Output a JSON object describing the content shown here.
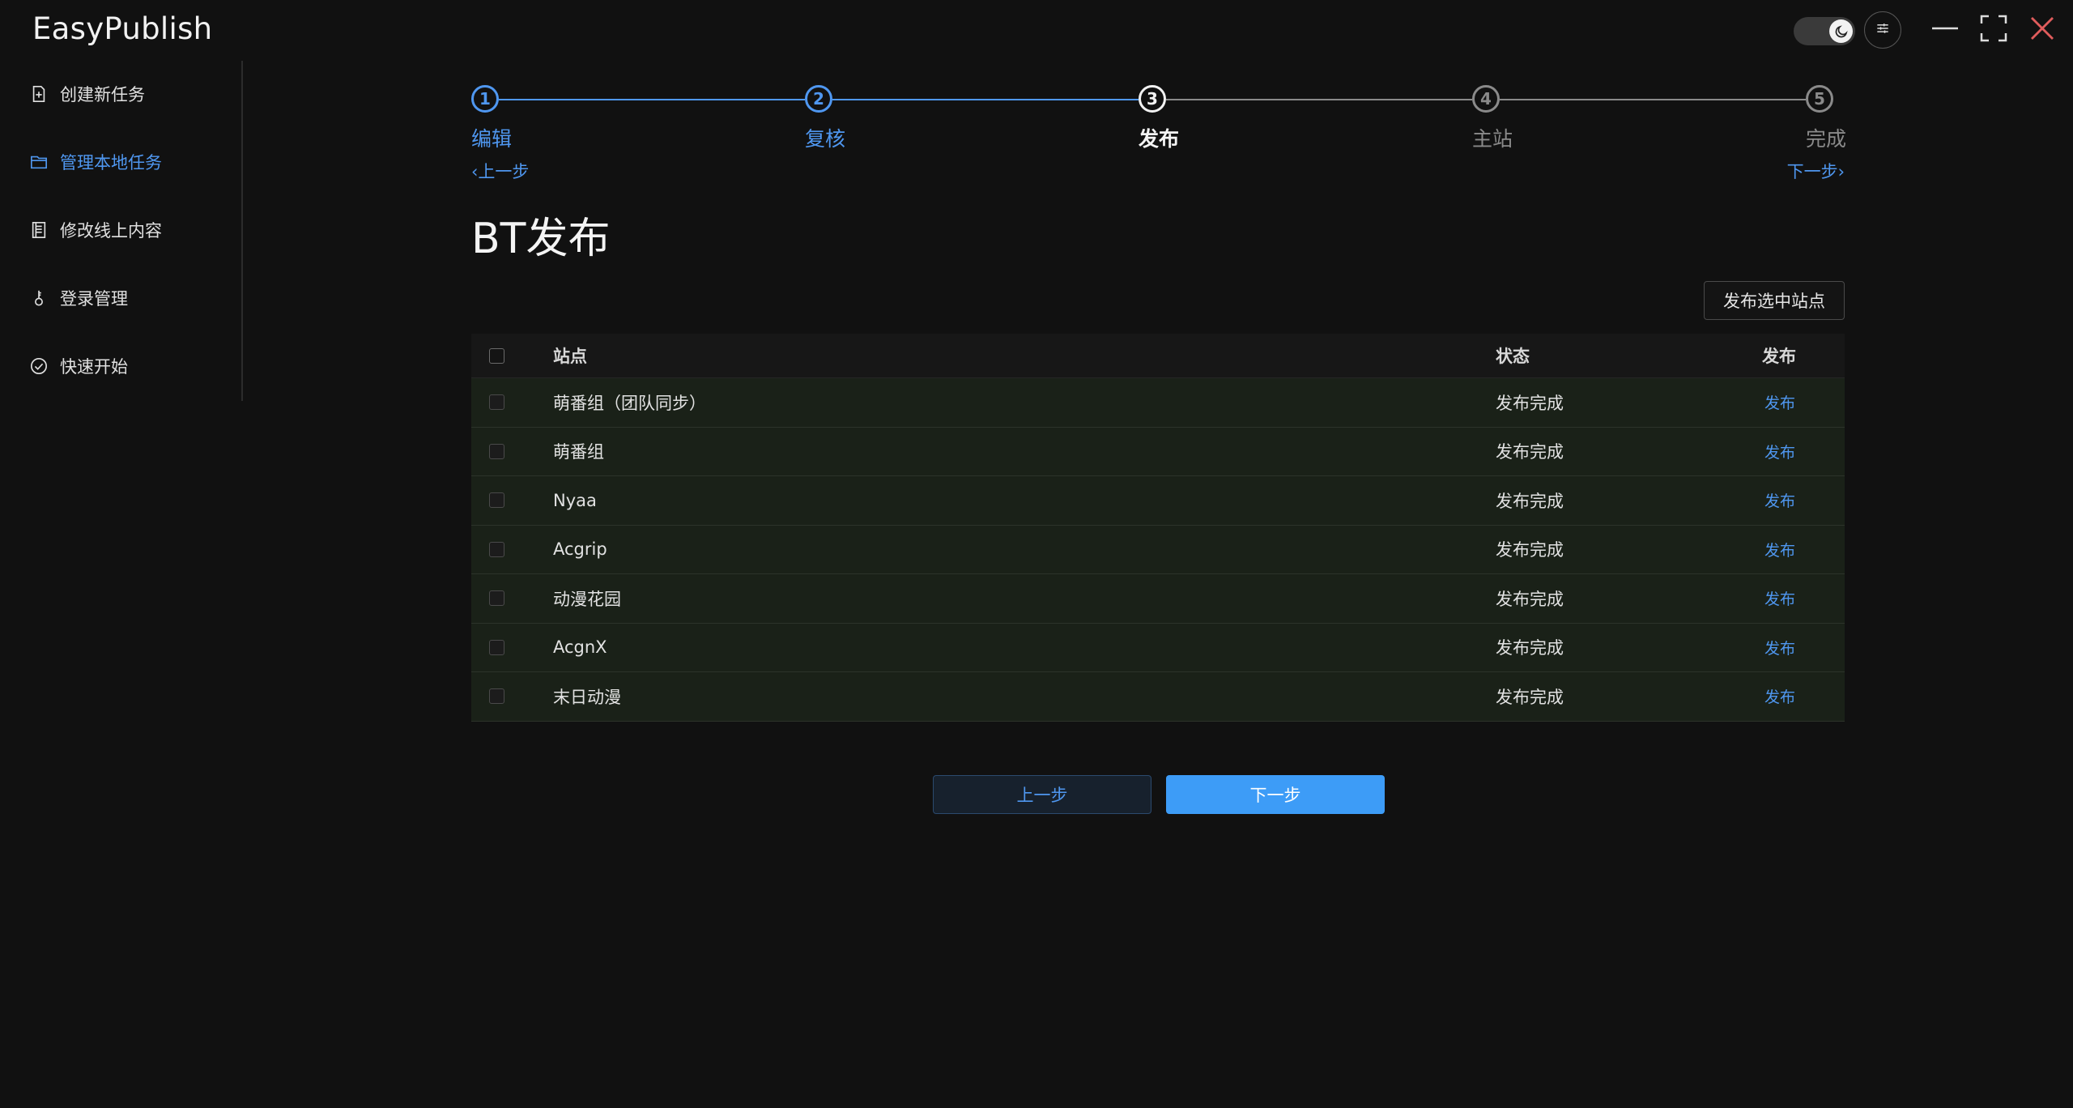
{
  "app": {
    "title": "EasyPublish"
  },
  "colors": {
    "accent": "#4f97f0",
    "primary_button": "#3d9cf7",
    "close_icon": "#e05c5c",
    "row_bg": "#1a2118"
  },
  "titlebar": {
    "theme_toggle_icon": "moon-icon",
    "settings_icon": "sliders-icon",
    "window_controls": [
      "minimize-icon",
      "maximize-icon",
      "close-icon"
    ]
  },
  "sidebar": {
    "items": [
      {
        "label": "创建新任务",
        "icon": "file-plus-icon",
        "active": false
      },
      {
        "label": "管理本地任务",
        "icon": "folder-icon",
        "active": true
      },
      {
        "label": "修改线上内容",
        "icon": "document-list-icon",
        "active": false
      },
      {
        "label": "登录管理",
        "icon": "key-icon",
        "active": false
      },
      {
        "label": "快速开始",
        "icon": "check-circle-icon",
        "active": false
      }
    ]
  },
  "steps": {
    "items": [
      {
        "number": "1",
        "label": "编辑",
        "state": "done"
      },
      {
        "number": "2",
        "label": "复核",
        "state": "done"
      },
      {
        "number": "3",
        "label": "发布",
        "state": "current"
      },
      {
        "number": "4",
        "label": "主站",
        "state": "pending"
      },
      {
        "number": "5",
        "label": "完成",
        "state": "pending"
      }
    ],
    "prev_link": "上一步",
    "next_link": "下一步"
  },
  "main": {
    "title": "BT发布",
    "publish_selected_label": "发布选中站点",
    "table": {
      "headers": {
        "site": "站点",
        "status": "状态",
        "publish": "发布"
      },
      "rows": [
        {
          "site": "萌番组（团队同步）",
          "status": "发布完成",
          "action": "发布"
        },
        {
          "site": "萌番组",
          "status": "发布完成",
          "action": "发布"
        },
        {
          "site": "Nyaa",
          "status": "发布完成",
          "action": "发布"
        },
        {
          "site": "Acgrip",
          "status": "发布完成",
          "action": "发布"
        },
        {
          "site": "动漫花园",
          "status": "发布完成",
          "action": "发布"
        },
        {
          "site": "AcgnX",
          "status": "发布完成",
          "action": "发布"
        },
        {
          "site": "末日动漫",
          "status": "发布完成",
          "action": "发布"
        }
      ]
    },
    "prev_button": "上一步",
    "next_button": "下一步"
  }
}
